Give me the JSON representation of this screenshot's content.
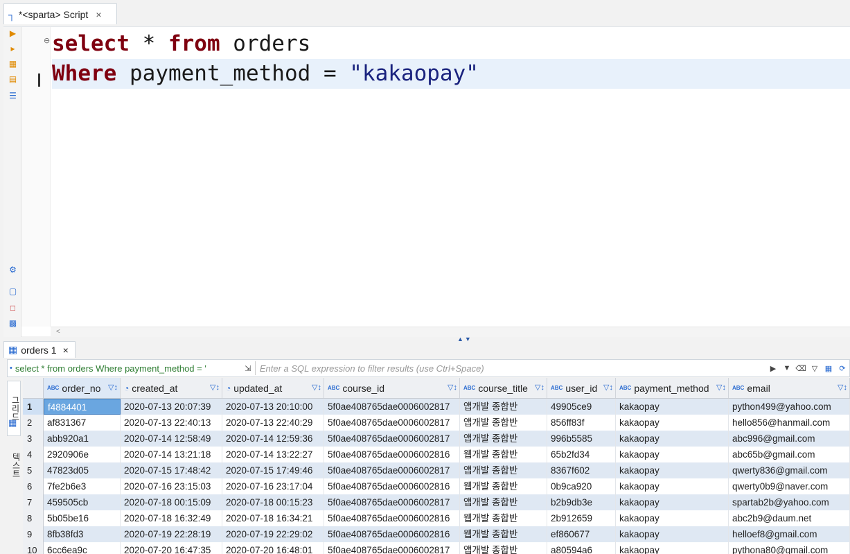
{
  "editor_tab": {
    "title": "*<sparta> Script",
    "icon": "sql-script-icon",
    "close": "×"
  },
  "editor": {
    "lines": [
      {
        "parts": [
          {
            "t": "select",
            "k": "kw"
          },
          {
            "t": " * ",
            "k": ""
          },
          {
            "t": "from",
            "k": "kw"
          },
          {
            "t": " orders",
            "k": ""
          }
        ]
      },
      {
        "parts": [
          {
            "t": "Where",
            "k": "kw"
          },
          {
            "t": " payment_method = ",
            "k": ""
          },
          {
            "t": "\"kakaopay\"",
            "k": "str"
          }
        ],
        "current": true
      }
    ],
    "fold_marker": "⊖",
    "hscroll_arrow": "<"
  },
  "results": {
    "tab_label": "orders 1",
    "tab_close": "×",
    "filter_query": "select * from orders Where payment_method = '",
    "filter_placeholder": "Enter a SQL expression to filter results (use Ctrl+Space)",
    "side_tabs": [
      "그리드",
      "텍스트"
    ],
    "columns": [
      {
        "name": "order_no",
        "type": "ABC",
        "sorted": true
      },
      {
        "name": "created_at",
        "type": "clock"
      },
      {
        "name": "updated_at",
        "type": "clock"
      },
      {
        "name": "course_id",
        "type": "ABC"
      },
      {
        "name": "course_title",
        "type": "ABC"
      },
      {
        "name": "user_id",
        "type": "ABC"
      },
      {
        "name": "payment_method",
        "type": "ABC"
      },
      {
        "name": "email",
        "type": "ABC"
      }
    ],
    "rows": [
      [
        "1",
        "f4884401",
        "2020-07-13 20:07:39",
        "2020-07-13 20:10:00",
        "5f0ae408765dae0006002817",
        "앱개발 종합반",
        "49905ce9",
        "kakaopay",
        "python499@yahoo.com"
      ],
      [
        "2",
        "af831367",
        "2020-07-13 22:40:13",
        "2020-07-13 22:40:29",
        "5f0ae408765dae0006002817",
        "앱개발 종합반",
        "856ff83f",
        "kakaopay",
        "hello856@hanmail.com"
      ],
      [
        "3",
        "abb920a1",
        "2020-07-14 12:58:49",
        "2020-07-14 12:59:36",
        "5f0ae408765dae0006002817",
        "앱개발 종합반",
        "996b5585",
        "kakaopay",
        "abc996@gmail.com"
      ],
      [
        "4",
        "2920906e",
        "2020-07-14 13:21:18",
        "2020-07-14 13:22:27",
        "5f0ae408765dae0006002816",
        "웹개발 종합반",
        "65b2fd34",
        "kakaopay",
        "abc65b@gmail.com"
      ],
      [
        "5",
        "47823d05",
        "2020-07-15 17:48:42",
        "2020-07-15 17:49:46",
        "5f0ae408765dae0006002817",
        "앱개발 종합반",
        "8367f602",
        "kakaopay",
        "qwerty836@gmail.com"
      ],
      [
        "6",
        "7fe2b6e3",
        "2020-07-16 23:15:03",
        "2020-07-16 23:17:04",
        "5f0ae408765dae0006002816",
        "웹개발 종합반",
        "0b9ca920",
        "kakaopay",
        "qwerty0b9@naver.com"
      ],
      [
        "7",
        "459505cb",
        "2020-07-18 00:15:09",
        "2020-07-18 00:15:23",
        "5f0ae408765dae0006002817",
        "앱개발 종합반",
        "b2b9db3e",
        "kakaopay",
        "spartab2b@yahoo.com"
      ],
      [
        "8",
        "5b05be16",
        "2020-07-18 16:32:49",
        "2020-07-18 16:34:21",
        "5f0ae408765dae0006002816",
        "웹개발 종합반",
        "2b912659",
        "kakaopay",
        "abc2b9@daum.net"
      ],
      [
        "9",
        "8fb38fd3",
        "2020-07-19 22:28:19",
        "2020-07-19 22:29:02",
        "5f0ae408765dae0006002816",
        "웹개발 종합반",
        "ef860677",
        "kakaopay",
        "helloef8@gmail.com"
      ],
      [
        "10",
        "6cc6ea9c",
        "2020-07-20 16:47:35",
        "2020-07-20 16:48:01",
        "5f0ae408765dae0006002817",
        "앱개발 종합반",
        "a80594a6",
        "kakaopay",
        "pythona80@gmail.com"
      ]
    ]
  },
  "colors": {
    "keyword": "#7f0010",
    "string": "#1a237e",
    "accent": "#2a6bd1",
    "row_alt": "#dfe8f3",
    "cell_focus": "#6aa6e0"
  },
  "icons": {
    "toolbar": [
      "execute-statement-icon",
      "execute-script-icon",
      "explain-plan-icon",
      "load-execution-plan-icon",
      "export-icon",
      "settings-icon",
      "open-script-icon",
      "new-script-icon",
      "format-icon"
    ],
    "filter": [
      "expand-filter-icon",
      "filter-history-icon",
      "dropdown-icon",
      "eraser-icon",
      "filter-settings-icon",
      "save-filter-icon",
      "refresh-icon"
    ]
  }
}
